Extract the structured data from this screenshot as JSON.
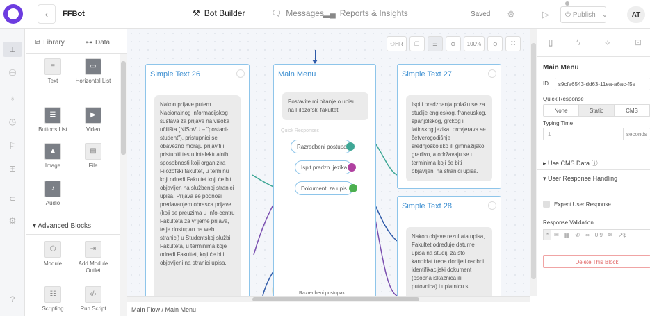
{
  "header": {
    "app_name": "FFBot",
    "tabs": [
      {
        "label": "Bot Builder",
        "icon": "tools-icon",
        "active": true
      },
      {
        "label": "Messages",
        "icon": "chat-icon",
        "active": false
      },
      {
        "label": "Reports & Insights",
        "icon": "bar-chart-icon",
        "active": false
      }
    ],
    "saved_label": "Saved",
    "publish_label": "Publish",
    "avatar_initials": "AT"
  },
  "library": {
    "tabs": [
      {
        "label": "Library",
        "icon": "library-icon"
      },
      {
        "label": "Data",
        "icon": "data-icon"
      }
    ],
    "blocks": [
      {
        "label": "Text",
        "icon": "text-block-icon"
      },
      {
        "label": "Horizontal List",
        "icon": "horizontal-list-icon"
      },
      {
        "label": "Buttons List",
        "icon": "buttons-list-icon"
      },
      {
        "label": "Video",
        "icon": "video-icon"
      },
      {
        "label": "Image",
        "icon": "image-icon"
      },
      {
        "label": "File",
        "icon": "file-icon"
      },
      {
        "label": "Audio",
        "icon": "audio-icon"
      }
    ],
    "advanced_header": "Advanced Blocks",
    "advanced_blocks": [
      {
        "label": "Module",
        "icon": "module-icon"
      },
      {
        "label": "Add Module Outlet",
        "icon": "module-outlet-icon"
      },
      {
        "label": "Scripting",
        "icon": "scripting-icon"
      },
      {
        "label": "Run Script",
        "icon": "run-script-icon"
      }
    ]
  },
  "canvas": {
    "toolbar": {
      "hr_label": "HR",
      "zoom": "100%"
    },
    "nodes": {
      "st26": {
        "title": "Simple Text 26",
        "text": "Nakon prijave putem Nacionalnog informacijskog sustava za prijave na visoka učilišta (NISpVU – \"postani-student\"), pristupnici se obavezno moraju prijaviti i pristupiti testu intelektualnih sposobnosti koji organizira Filozofski fakultet, u terminu koji odredi Fakultet koji će bit objavljen na službenoj stranici upisa. Prijava se podnosi predavanjem obrasca prijave (koji se preuzima u Info-centru Fakulteta za vrijeme prijava, te je dostupan na web stranici) u Studentskoj službi Fakulteta, u terminima koje odredi Fakultet, koji će biti objavljeni na stranici upisa."
      },
      "main": {
        "title": "Main Menu",
        "text": "Postavite mi pitanje o upisu na Filozofski fakultet!",
        "qr_label": "Quick Responses",
        "quick_responses": [
          "Razredbeni postupak",
          "Ispit predzn. jezika",
          "Dokumenti za upis"
        ],
        "partial_item": "Razredbeni postupak"
      },
      "st27": {
        "title": "Simple Text 27",
        "text": "Ispiti predznanja polažu se za studije engleskog, francuskog, španjolskog, grčkog i latinskog jezika, provjerava se četverogodišnje srednjoškolsko ili gimnazijsko gradivo, a održavaju se u terminima koji će biti objavljeni na stranici upisa."
      },
      "st28": {
        "title": "Simple Text 28",
        "text": "Nakon objave rezultata upisa, Fakultet određuje datume upisa na studij, za što kandidat treba donijeti osobni identifikacijski dokument (osobna iskaznica ili putovnica) i uplatnicu s"
      }
    },
    "colors": {
      "teal": "#3fa796",
      "purple": "#7a4fb0",
      "green": "#4caf50",
      "magenta": "#b040a0",
      "olive": "#c9b23a",
      "navy": "#2f5aa8"
    }
  },
  "breadcrumb": "Main Flow / Main Menu",
  "right_panel": {
    "title": "Main Menu",
    "id_label": "ID",
    "id_value": "s9cfe6543-dd63-11ea-a6ac-f5e",
    "quick_response_label": "Quick Response",
    "quick_response_options": [
      "None",
      "Static",
      "CMS"
    ],
    "quick_response_selected": "Static",
    "typing_time_label": "Typing Time",
    "typing_time_value": "1",
    "typing_time_unit": "seconds",
    "use_cms_label": "Use CMS Data",
    "user_response_label": "User Response Handling",
    "expect_label": "Expect User Response",
    "response_validation_label": "Response Validation",
    "validation_options": [
      "*",
      "✉",
      "▦",
      "✆",
      "∞",
      "0.9",
      "✉",
      "↗$"
    ],
    "delete_label": "Delete This Block"
  }
}
